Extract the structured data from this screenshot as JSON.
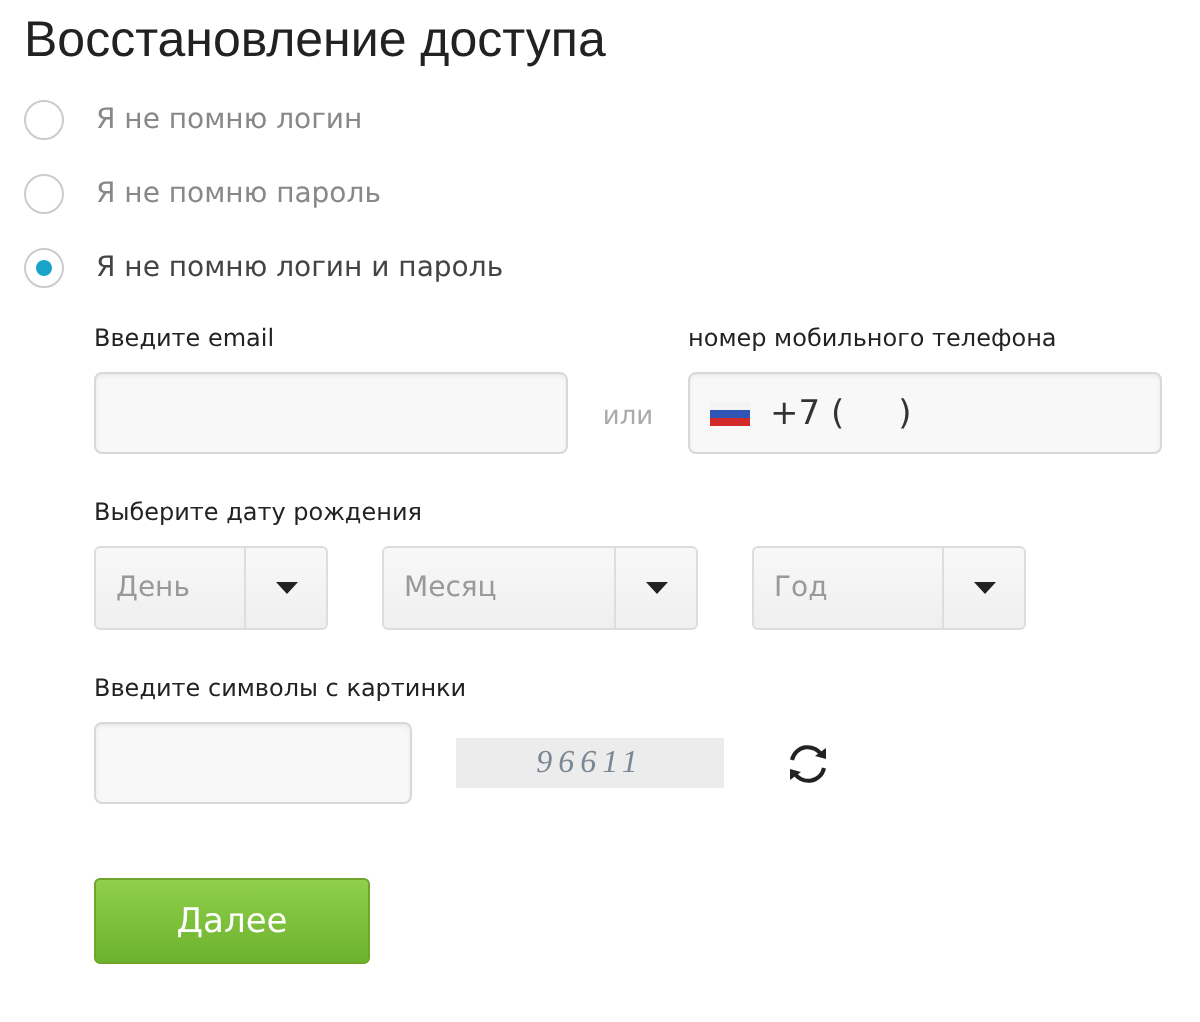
{
  "title": "Восстановление доступа",
  "options": [
    {
      "label": "Я не помню логин",
      "selected": false
    },
    {
      "label": "Я не помню пароль",
      "selected": false
    },
    {
      "label": "Я не помню логин и пароль",
      "selected": true
    }
  ],
  "email": {
    "label": "Введите email"
  },
  "separator": "или",
  "phone": {
    "label": "номер мобильного телефона",
    "value": "+7 (     )"
  },
  "birthdate": {
    "label": "Выберите дату рождения",
    "selects": [
      {
        "placeholder": "День"
      },
      {
        "placeholder": "Месяц"
      },
      {
        "placeholder": "Год"
      }
    ]
  },
  "captcha": {
    "label": "Введите символы с картинки",
    "code": "96611"
  },
  "submit": "Далее"
}
